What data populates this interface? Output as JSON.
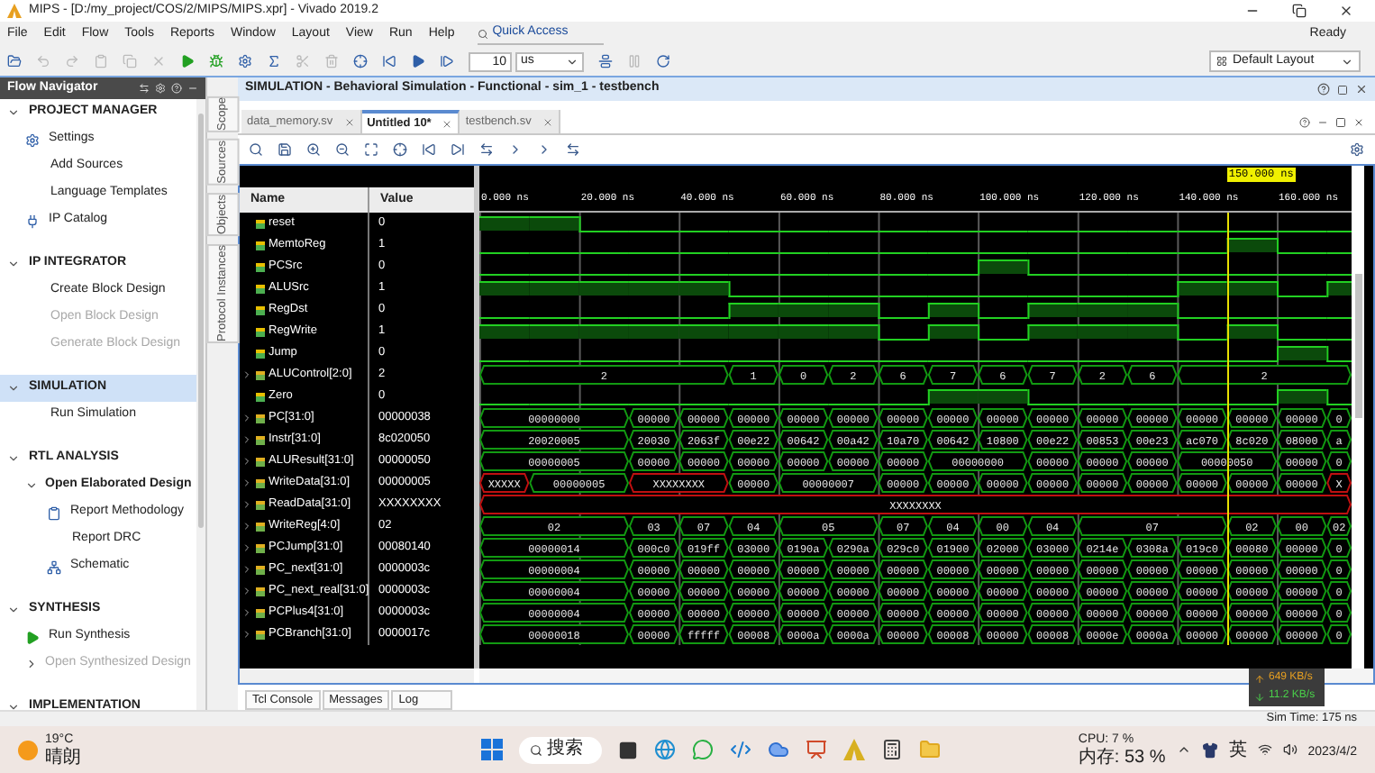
{
  "window": {
    "title": "MIPS - [D:/my_project/COS/2/MIPS/MIPS.xpr] - Vivado 2019.2"
  },
  "menu": [
    "File",
    "Edit",
    "Flow",
    "Tools",
    "Reports",
    "Window",
    "Layout",
    "View",
    "Run",
    "Help"
  ],
  "quick_access": {
    "placeholder": "Quick Access"
  },
  "status": "Ready",
  "toolbar": {
    "step_value": "10",
    "step_unit": "us",
    "layout": "Default Layout"
  },
  "flow_navigator": {
    "title": "Flow Navigator",
    "sections": [
      {
        "label": "PROJECT MANAGER",
        "expanded": true,
        "selected": false,
        "items": [
          {
            "kind": "link",
            "label": "Settings",
            "disabled": false
          },
          {
            "kind": "link",
            "label": "Add Sources",
            "disabled": false
          },
          {
            "kind": "link",
            "label": "Language Templates",
            "disabled": false
          },
          {
            "kind": "link",
            "label": "IP Catalog",
            "disabled": false
          }
        ]
      },
      {
        "label": "IP INTEGRATOR",
        "expanded": true,
        "selected": false,
        "items": [
          {
            "kind": "link",
            "label": "Create Block Design",
            "disabled": false
          },
          {
            "kind": "link",
            "label": "Open Block Design",
            "disabled": true
          },
          {
            "kind": "link",
            "label": "Generate Block Design",
            "disabled": true
          }
        ]
      },
      {
        "label": "SIMULATION",
        "expanded": true,
        "selected": true,
        "items": [
          {
            "kind": "link",
            "label": "Run Simulation",
            "disabled": false
          }
        ]
      },
      {
        "label": "RTL ANALYSIS",
        "expanded": true,
        "selected": false,
        "items": [
          {
            "kind": "group",
            "label": "Open Elaborated Design",
            "expanded": true,
            "disabled": false,
            "children": [
              {
                "kind": "link",
                "label": "Report Methodology",
                "disabled": false
              },
              {
                "kind": "link",
                "label": "Report DRC",
                "disabled": false
              },
              {
                "kind": "link",
                "label": "Schematic",
                "disabled": false
              }
            ]
          }
        ]
      },
      {
        "label": "SYNTHESIS",
        "expanded": true,
        "selected": false,
        "items": [
          {
            "kind": "link",
            "label": "Run Synthesis",
            "disabled": false
          },
          {
            "kind": "group",
            "label": "Open Synthesized Design",
            "expanded": false,
            "disabled": true
          }
        ]
      },
      {
        "label": "IMPLEMENTATION",
        "expanded": true,
        "selected": false
      }
    ]
  },
  "side_tabs": [
    "Scope",
    "Sources",
    "Objects",
    "Protocol Instances"
  ],
  "panel_title": "SIMULATION - Behavioral Simulation - Functional - sim_1 - testbench",
  "editor_tabs": [
    {
      "label": "data_memory.sv",
      "selected": false
    },
    {
      "label": "Untitled 10*",
      "selected": true
    },
    {
      "label": "testbench.sv",
      "selected": false
    }
  ],
  "waveform": {
    "columns": [
      "Name",
      "Value"
    ],
    "cursor": {
      "label": "150.000 ns"
    },
    "ticks": [
      "0.000 ns",
      "20.000 ns",
      "40.000 ns",
      "60.000 ns",
      "80.000 ns",
      "100.000 ns",
      "120.000 ns",
      "140.000 ns",
      "160.000 ns"
    ],
    "signals": [
      {
        "kind": "bit",
        "name": "reset",
        "value": "0",
        "cycles": [
          {
            "high": true
          },
          {
            "high": true
          },
          {
            "high": false
          },
          {
            "high": false
          },
          {
            "high": false
          },
          {
            "high": false
          },
          {
            "high": false
          },
          {
            "high": false
          },
          {
            "high": false
          },
          {
            "high": false
          },
          {
            "high": false
          },
          {
            "high": false
          },
          {
            "high": false
          },
          {
            "high": false
          },
          {
            "high": false
          },
          {
            "high": false
          },
          {
            "high": false
          },
          {
            "high": false
          }
        ]
      },
      {
        "kind": "bit",
        "name": "MemtoReg",
        "value": "1",
        "cycles": [
          {
            "high": false
          },
          {
            "high": false
          },
          {
            "high": false
          },
          {
            "high": false
          },
          {
            "high": false
          },
          {
            "high": false
          },
          {
            "high": false
          },
          {
            "high": false
          },
          {
            "high": false
          },
          {
            "high": false
          },
          {
            "high": false
          },
          {
            "high": false
          },
          {
            "high": false
          },
          {
            "high": false
          },
          {
            "high": false
          },
          {
            "high": true
          },
          {
            "high": false
          },
          {
            "high": false
          }
        ]
      },
      {
        "kind": "bit",
        "name": "PCSrc",
        "value": "0",
        "cycles": [
          {
            "high": false
          },
          {
            "high": false
          },
          {
            "high": false
          },
          {
            "high": false
          },
          {
            "high": false
          },
          {
            "high": false
          },
          {
            "high": false
          },
          {
            "high": false
          },
          {
            "high": false
          },
          {
            "high": false
          },
          {
            "high": true
          },
          {
            "high": false
          },
          {
            "high": false
          },
          {
            "high": false
          },
          {
            "high": false
          },
          {
            "high": false
          },
          {
            "high": false
          },
          {
            "high": false
          }
        ]
      },
      {
        "kind": "bit",
        "name": "ALUSrc",
        "value": "1",
        "cycles": [
          {
            "high": true
          },
          {
            "high": true
          },
          {
            "high": true
          },
          {
            "high": true
          },
          {
            "high": true
          },
          {
            "high": false
          },
          {
            "high": false
          },
          {
            "high": false
          },
          {
            "high": false
          },
          {
            "high": false
          },
          {
            "high": false
          },
          {
            "high": false
          },
          {
            "high": false
          },
          {
            "high": false
          },
          {
            "high": true
          },
          {
            "high": true
          },
          {
            "high": false
          },
          {
            "high": true
          }
        ]
      },
      {
        "kind": "bit",
        "name": "RegDst",
        "value": "0",
        "cycles": [
          {
            "high": false
          },
          {
            "high": false
          },
          {
            "high": false
          },
          {
            "high": false
          },
          {
            "high": false
          },
          {
            "high": true
          },
          {
            "high": true
          },
          {
            "high": true
          },
          {
            "high": false
          },
          {
            "high": true
          },
          {
            "high": false
          },
          {
            "high": true
          },
          {
            "high": true
          },
          {
            "high": true
          },
          {
            "high": false
          },
          {
            "high": false
          },
          {
            "high": false
          },
          {
            "high": false
          }
        ]
      },
      {
        "kind": "bit",
        "name": "RegWrite",
        "value": "1",
        "cycles": [
          {
            "high": true
          },
          {
            "high": true
          },
          {
            "high": true
          },
          {
            "high": true
          },
          {
            "high": true
          },
          {
            "high": true
          },
          {
            "high": true
          },
          {
            "high": true
          },
          {
            "high": false
          },
          {
            "high": true
          },
          {
            "high": false
          },
          {
            "high": true
          },
          {
            "high": true
          },
          {
            "high": true
          },
          {
            "high": false
          },
          {
            "high": true
          },
          {
            "high": false
          },
          {
            "high": false
          }
        ]
      },
      {
        "kind": "bit",
        "name": "Jump",
        "value": "0",
        "cycles": [
          {
            "high": false
          },
          {
            "high": false
          },
          {
            "high": false
          },
          {
            "high": false
          },
          {
            "high": false
          },
          {
            "high": false
          },
          {
            "high": false
          },
          {
            "high": false
          },
          {
            "high": false
          },
          {
            "high": false
          },
          {
            "high": false
          },
          {
            "high": false
          },
          {
            "high": false
          },
          {
            "high": false
          },
          {
            "high": false
          },
          {
            "high": false
          },
          {
            "high": true
          },
          {
            "high": false
          }
        ]
      },
      {
        "kind": "bus",
        "name": "ALUControl[2:0]",
        "value": "2",
        "cycles": [
          {
            "kind": "start",
            "value": "2",
            "unknown": false
          },
          {
            "kind": "hold"
          },
          {
            "kind": "hold"
          },
          {
            "kind": "hold"
          },
          {
            "kind": "hold"
          },
          {
            "kind": "start",
            "value": "1",
            "unknown": false
          },
          {
            "kind": "start",
            "value": "0",
            "unknown": false
          },
          {
            "kind": "start",
            "value": "2",
            "unknown": false
          },
          {
            "kind": "start",
            "value": "6",
            "unknown": false
          },
          {
            "kind": "start",
            "value": "7",
            "unknown": false
          },
          {
            "kind": "start",
            "value": "6",
            "unknown": false
          },
          {
            "kind": "start",
            "value": "7",
            "unknown": false
          },
          {
            "kind": "start",
            "value": "2",
            "unknown": false
          },
          {
            "kind": "start",
            "value": "6",
            "unknown": false
          },
          {
            "kind": "start",
            "value": "2",
            "unknown": false
          },
          {
            "kind": "hold"
          },
          {
            "kind": "hold"
          },
          {
            "kind": "hold"
          }
        ]
      },
      {
        "kind": "bit",
        "name": "Zero",
        "value": "0",
        "cycles": [
          {
            "high": false
          },
          {
            "high": false
          },
          {
            "high": false
          },
          {
            "high": false
          },
          {
            "high": false
          },
          {
            "high": false
          },
          {
            "high": false
          },
          {
            "high": false
          },
          {
            "high": false
          },
          {
            "high": true
          },
          {
            "high": true
          },
          {
            "high": false
          },
          {
            "high": false
          },
          {
            "high": false
          },
          {
            "high": false
          },
          {
            "high": false
          },
          {
            "high": true
          },
          {
            "high": false
          }
        ]
      },
      {
        "kind": "bus",
        "name": "PC[31:0]",
        "value": "00000038",
        "cycles": [
          {
            "kind": "start",
            "value": "00000000",
            "unknown": false
          },
          {
            "kind": "hold"
          },
          {
            "kind": "hold"
          },
          {
            "kind": "start",
            "value": "00000",
            "unknown": false
          },
          {
            "kind": "start",
            "value": "00000",
            "unknown": false
          },
          {
            "kind": "start",
            "value": "00000",
            "unknown": false
          },
          {
            "kind": "start",
            "value": "00000",
            "unknown": false
          },
          {
            "kind": "start",
            "value": "00000",
            "unknown": false
          },
          {
            "kind": "start",
            "value": "00000",
            "unknown": false
          },
          {
            "kind": "start",
            "value": "00000",
            "unknown": false
          },
          {
            "kind": "start",
            "value": "00000",
            "unknown": false
          },
          {
            "kind": "start",
            "value": "00000",
            "unknown": false
          },
          {
            "kind": "start",
            "value": "00000",
            "unknown": false
          },
          {
            "kind": "start",
            "value": "00000",
            "unknown": false
          },
          {
            "kind": "start",
            "value": "00000",
            "unknown": false
          },
          {
            "kind": "start",
            "value": "00000",
            "unknown": false
          },
          {
            "kind": "start",
            "value": "00000",
            "unknown": false
          },
          {
            "kind": "start",
            "value": "0",
            "unknown": false
          }
        ]
      },
      {
        "kind": "bus",
        "name": "Instr[31:0]",
        "value": "8c020050",
        "cycles": [
          {
            "kind": "start",
            "value": "20020005",
            "unknown": false
          },
          {
            "kind": "hold"
          },
          {
            "kind": "hold"
          },
          {
            "kind": "start",
            "value": "20030",
            "unknown": false
          },
          {
            "kind": "start",
            "value": "2063f",
            "unknown": false
          },
          {
            "kind": "start",
            "value": "00e22",
            "unknown": false
          },
          {
            "kind": "start",
            "value": "00642",
            "unknown": false
          },
          {
            "kind": "start",
            "value": "00a42",
            "unknown": false
          },
          {
            "kind": "start",
            "value": "10a70",
            "unknown": false
          },
          {
            "kind": "start",
            "value": "00642",
            "unknown": false
          },
          {
            "kind": "start",
            "value": "10800",
            "unknown": false
          },
          {
            "kind": "start",
            "value": "00e22",
            "unknown": false
          },
          {
            "kind": "start",
            "value": "00853",
            "unknown": false
          },
          {
            "kind": "start",
            "value": "00e23",
            "unknown": false
          },
          {
            "kind": "start",
            "value": "ac070",
            "unknown": false
          },
          {
            "kind": "start",
            "value": "8c020",
            "unknown": false
          },
          {
            "kind": "start",
            "value": "08000",
            "unknown": false
          },
          {
            "kind": "start",
            "value": "a",
            "unknown": false
          }
        ]
      },
      {
        "kind": "bus",
        "name": "ALUResult[31:0]",
        "value": "00000050",
        "cycles": [
          {
            "kind": "start",
            "value": "00000005",
            "unknown": false
          },
          {
            "kind": "hold"
          },
          {
            "kind": "hold"
          },
          {
            "kind": "start",
            "value": "00000",
            "unknown": false
          },
          {
            "kind": "start",
            "value": "00000",
            "unknown": false
          },
          {
            "kind": "start",
            "value": "00000",
            "unknown": false
          },
          {
            "kind": "start",
            "value": "00000",
            "unknown": false
          },
          {
            "kind": "start",
            "value": "00000",
            "unknown": false
          },
          {
            "kind": "start",
            "value": "00000",
            "unknown": false
          },
          {
            "kind": "start",
            "value": "00000000",
            "unknown": false
          },
          {
            "kind": "hold"
          },
          {
            "kind": "start",
            "value": "00000",
            "unknown": false
          },
          {
            "kind": "start",
            "value": "00000",
            "unknown": false
          },
          {
            "kind": "start",
            "value": "00000",
            "unknown": false
          },
          {
            "kind": "start",
            "value": "00000050",
            "unknown": false
          },
          {
            "kind": "hold"
          },
          {
            "kind": "start",
            "value": "00000",
            "unknown": false
          },
          {
            "kind": "start",
            "value": "0",
            "unknown": false
          }
        ]
      },
      {
        "kind": "bus",
        "name": "WriteData[31:0]",
        "value": "00000005",
        "cycles": [
          {
            "kind": "start",
            "value": "XXXXX",
            "unknown": true
          },
          {
            "kind": "start",
            "value": "00000005",
            "unknown": false
          },
          {
            "kind": "hold"
          },
          {
            "kind": "start",
            "value": "XXXXXXXX",
            "unknown": true
          },
          {
            "kind": "hold"
          },
          {
            "kind": "start",
            "value": "00000",
            "unknown": false
          },
          {
            "kind": "start",
            "value": "00000007",
            "unknown": false
          },
          {
            "kind": "hold"
          },
          {
            "kind": "start",
            "value": "00000",
            "unknown": false
          },
          {
            "kind": "start",
            "value": "00000",
            "unknown": false
          },
          {
            "kind": "start",
            "value": "00000",
            "unknown": false
          },
          {
            "kind": "start",
            "value": "00000",
            "unknown": false
          },
          {
            "kind": "start",
            "value": "00000",
            "unknown": false
          },
          {
            "kind": "start",
            "value": "00000",
            "unknown": false
          },
          {
            "kind": "start",
            "value": "00000",
            "unknown": false
          },
          {
            "kind": "start",
            "value": "00000",
            "unknown": false
          },
          {
            "kind": "start",
            "value": "00000",
            "unknown": false
          },
          {
            "kind": "start",
            "value": "X",
            "unknown": true
          }
        ]
      },
      {
        "kind": "bus",
        "name": "ReadData[31:0]",
        "value": "XXXXXXXX",
        "cycles": [
          {
            "kind": "start",
            "value": "XXXXXXXX",
            "unknown": true
          },
          {
            "kind": "hold"
          },
          {
            "kind": "hold"
          },
          {
            "kind": "hold"
          },
          {
            "kind": "hold"
          },
          {
            "kind": "hold"
          },
          {
            "kind": "hold"
          },
          {
            "kind": "hold"
          },
          {
            "kind": "hold"
          },
          {
            "kind": "hold"
          },
          {
            "kind": "hold"
          },
          {
            "kind": "hold"
          },
          {
            "kind": "hold"
          },
          {
            "kind": "hold"
          },
          {
            "kind": "hold"
          },
          {
            "kind": "hold"
          },
          {
            "kind": "hold"
          },
          {
            "kind": "hold"
          }
        ]
      },
      {
        "kind": "bus",
        "name": "WriteReg[4:0]",
        "value": "02",
        "cycles": [
          {
            "kind": "start",
            "value": "02",
            "unknown": false
          },
          {
            "kind": "hold"
          },
          {
            "kind": "hold"
          },
          {
            "kind": "start",
            "value": "03",
            "unknown": false
          },
          {
            "kind": "start",
            "value": "07",
            "unknown": false
          },
          {
            "kind": "start",
            "value": "04",
            "unknown": false
          },
          {
            "kind": "start",
            "value": "05",
            "unknown": false
          },
          {
            "kind": "hold"
          },
          {
            "kind": "start",
            "value": "07",
            "unknown": false
          },
          {
            "kind": "start",
            "value": "04",
            "unknown": false
          },
          {
            "kind": "start",
            "value": "00",
            "unknown": false
          },
          {
            "kind": "start",
            "value": "04",
            "unknown": false
          },
          {
            "kind": "start",
            "value": "07",
            "unknown": false
          },
          {
            "kind": "hold"
          },
          {
            "kind": "hold"
          },
          {
            "kind": "start",
            "value": "02",
            "unknown": false
          },
          {
            "kind": "start",
            "value": "00",
            "unknown": false
          },
          {
            "kind": "start",
            "value": "02",
            "unknown": false
          }
        ]
      },
      {
        "kind": "bus",
        "name": "PCJump[31:0]",
        "value": "00080140",
        "cycles": [
          {
            "kind": "start",
            "value": "00000014",
            "unknown": false
          },
          {
            "kind": "hold"
          },
          {
            "kind": "hold"
          },
          {
            "kind": "start",
            "value": "000c0",
            "unknown": false
          },
          {
            "kind": "start",
            "value": "019ff",
            "unknown": false
          },
          {
            "kind": "start",
            "value": "03000",
            "unknown": false
          },
          {
            "kind": "start",
            "value": "0190a",
            "unknown": false
          },
          {
            "kind": "start",
            "value": "0290a",
            "unknown": false
          },
          {
            "kind": "start",
            "value": "029c0",
            "unknown": false
          },
          {
            "kind": "start",
            "value": "01900",
            "unknown": false
          },
          {
            "kind": "start",
            "value": "02000",
            "unknown": false
          },
          {
            "kind": "start",
            "value": "03000",
            "unknown": false
          },
          {
            "kind": "start",
            "value": "0214e",
            "unknown": false
          },
          {
            "kind": "start",
            "value": "0308a",
            "unknown": false
          },
          {
            "kind": "start",
            "value": "019c0",
            "unknown": false
          },
          {
            "kind": "start",
            "value": "00080",
            "unknown": false
          },
          {
            "kind": "start",
            "value": "00000",
            "unknown": false
          },
          {
            "kind": "start",
            "value": "0",
            "unknown": false
          }
        ]
      },
      {
        "kind": "bus",
        "name": "PC_next[31:0]",
        "value": "0000003c",
        "cycles": [
          {
            "kind": "start",
            "value": "00000004",
            "unknown": false
          },
          {
            "kind": "hold"
          },
          {
            "kind": "hold"
          },
          {
            "kind": "start",
            "value": "00000",
            "unknown": false
          },
          {
            "kind": "start",
            "value": "00000",
            "unknown": false
          },
          {
            "kind": "start",
            "value": "00000",
            "unknown": false
          },
          {
            "kind": "start",
            "value": "00000",
            "unknown": false
          },
          {
            "kind": "start",
            "value": "00000",
            "unknown": false
          },
          {
            "kind": "start",
            "value": "00000",
            "unknown": false
          },
          {
            "kind": "start",
            "value": "00000",
            "unknown": false
          },
          {
            "kind": "start",
            "value": "00000",
            "unknown": false
          },
          {
            "kind": "start",
            "value": "00000",
            "unknown": false
          },
          {
            "kind": "start",
            "value": "00000",
            "unknown": false
          },
          {
            "kind": "start",
            "value": "00000",
            "unknown": false
          },
          {
            "kind": "start",
            "value": "00000",
            "unknown": false
          },
          {
            "kind": "start",
            "value": "00000",
            "unknown": false
          },
          {
            "kind": "start",
            "value": "00000",
            "unknown": false
          },
          {
            "kind": "start",
            "value": "0",
            "unknown": false
          }
        ]
      },
      {
        "kind": "bus",
        "name": "PC_next_real[31:0]",
        "value": "0000003c",
        "cycles": [
          {
            "kind": "start",
            "value": "00000004",
            "unknown": false
          },
          {
            "kind": "hold"
          },
          {
            "kind": "hold"
          },
          {
            "kind": "start",
            "value": "00000",
            "unknown": false
          },
          {
            "kind": "start",
            "value": "00000",
            "unknown": false
          },
          {
            "kind": "start",
            "value": "00000",
            "unknown": false
          },
          {
            "kind": "start",
            "value": "00000",
            "unknown": false
          },
          {
            "kind": "start",
            "value": "00000",
            "unknown": false
          },
          {
            "kind": "start",
            "value": "00000",
            "unknown": false
          },
          {
            "kind": "start",
            "value": "00000",
            "unknown": false
          },
          {
            "kind": "start",
            "value": "00000",
            "unknown": false
          },
          {
            "kind": "start",
            "value": "00000",
            "unknown": false
          },
          {
            "kind": "start",
            "value": "00000",
            "unknown": false
          },
          {
            "kind": "start",
            "value": "00000",
            "unknown": false
          },
          {
            "kind": "start",
            "value": "00000",
            "unknown": false
          },
          {
            "kind": "start",
            "value": "00000",
            "unknown": false
          },
          {
            "kind": "start",
            "value": "00000",
            "unknown": false
          },
          {
            "kind": "start",
            "value": "0",
            "unknown": false
          }
        ]
      },
      {
        "kind": "bus",
        "name": "PCPlus4[31:0]",
        "value": "0000003c",
        "cycles": [
          {
            "kind": "start",
            "value": "00000004",
            "unknown": false
          },
          {
            "kind": "hold"
          },
          {
            "kind": "hold"
          },
          {
            "kind": "start",
            "value": "00000",
            "unknown": false
          },
          {
            "kind": "start",
            "value": "00000",
            "unknown": false
          },
          {
            "kind": "start",
            "value": "00000",
            "unknown": false
          },
          {
            "kind": "start",
            "value": "00000",
            "unknown": false
          },
          {
            "kind": "start",
            "value": "00000",
            "unknown": false
          },
          {
            "kind": "start",
            "value": "00000",
            "unknown": false
          },
          {
            "kind": "start",
            "value": "00000",
            "unknown": false
          },
          {
            "kind": "start",
            "value": "00000",
            "unknown": false
          },
          {
            "kind": "start",
            "value": "00000",
            "unknown": false
          },
          {
            "kind": "start",
            "value": "00000",
            "unknown": false
          },
          {
            "kind": "start",
            "value": "00000",
            "unknown": false
          },
          {
            "kind": "start",
            "value": "00000",
            "unknown": false
          },
          {
            "kind": "start",
            "value": "00000",
            "unknown": false
          },
          {
            "kind": "start",
            "value": "00000",
            "unknown": false
          },
          {
            "kind": "start",
            "value": "0",
            "unknown": false
          }
        ]
      },
      {
        "kind": "bus",
        "name": "PCBranch[31:0]",
        "value": "0000017c",
        "cycles": [
          {
            "kind": "start",
            "value": "00000018",
            "unknown": false
          },
          {
            "kind": "hold"
          },
          {
            "kind": "hold"
          },
          {
            "kind": "start",
            "value": "00000",
            "unknown": false
          },
          {
            "kind": "start",
            "value": "fffff",
            "unknown": false
          },
          {
            "kind": "start",
            "value": "00008",
            "unknown": false
          },
          {
            "kind": "start",
            "value": "0000a",
            "unknown": false
          },
          {
            "kind": "start",
            "value": "0000a",
            "unknown": false
          },
          {
            "kind": "start",
            "value": "00000",
            "unknown": false
          },
          {
            "kind": "start",
            "value": "00008",
            "unknown": false
          },
          {
            "kind": "start",
            "value": "00000",
            "unknown": false
          },
          {
            "kind": "start",
            "value": "00008",
            "unknown": false
          },
          {
            "kind": "start",
            "value": "0000e",
            "unknown": false
          },
          {
            "kind": "start",
            "value": "0000a",
            "unknown": false
          },
          {
            "kind": "start",
            "value": "00000",
            "unknown": false
          },
          {
            "kind": "start",
            "value": "00000",
            "unknown": false
          },
          {
            "kind": "start",
            "value": "00000",
            "unknown": false
          },
          {
            "kind": "start",
            "value": "0",
            "unknown": false
          }
        ]
      }
    ]
  },
  "bottom_tabs": [
    "Tcl Console",
    "Messages",
    "Log"
  ],
  "sim_time": "Sim Time: 175 ns",
  "network": {
    "up": "649 KB/s",
    "down": "11.2 KB/s"
  },
  "taskbar": {
    "temperature": "19°C",
    "weather": "晴朗",
    "search": "搜索",
    "cpu": "CPU: 7 %",
    "memory": "内存: 53 %",
    "input_method": "英",
    "date": "2023/4/2"
  }
}
